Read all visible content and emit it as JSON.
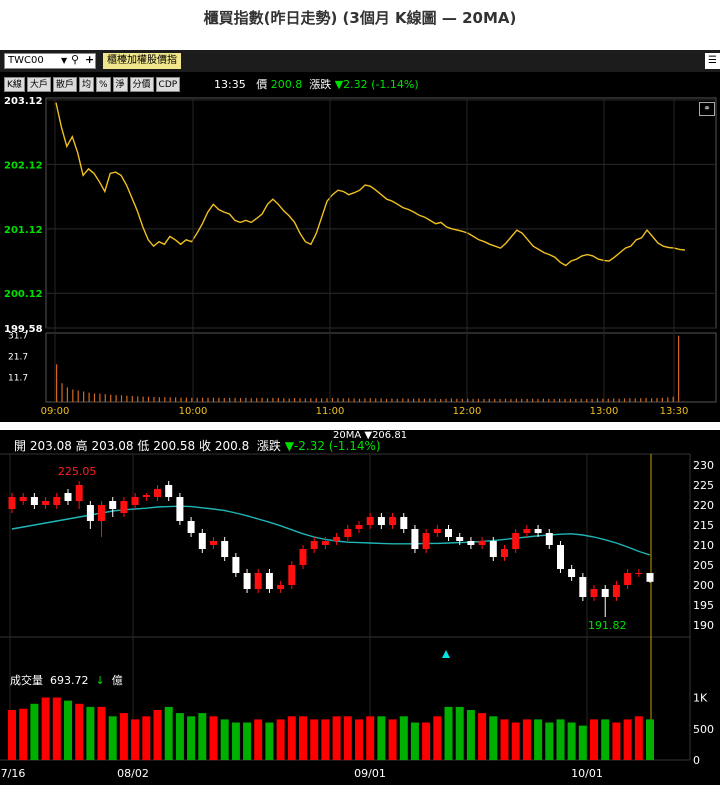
{
  "page_title": "櫃買指數(昨日走勢) (3個月 K線圖 — 20MA)",
  "toolbar": {
    "symbol": "TWC00",
    "index_name": "櫃檯加權股價指",
    "buttons": [
      "K線",
      "大戶",
      "散戶",
      "均",
      "%",
      "淨",
      "分價",
      "CDP"
    ],
    "time": "13:35",
    "price_label": "價",
    "price": "200.8",
    "change_label": "漲跌",
    "change": "▼2.32 (-1.14%)"
  },
  "colors": {
    "up": "#ff1010",
    "down": "#ffffff",
    "volume_up": "#ff0000",
    "volume_down": "#00b000",
    "ma": "#1fb5b5",
    "intraday": "#f0c020",
    "intraday_volume": "#d2691e"
  },
  "chart_data": [
    {
      "type": "line",
      "title": "",
      "x_ticks": [
        "09:00",
        "10:00",
        "11:00",
        "12:00",
        "13:00",
        "13:30"
      ],
      "y_ticks": [
        "203.12",
        "202.12",
        "201.12",
        "200.12",
        "199.58"
      ],
      "ylim": [
        199.58,
        203.12
      ],
      "series": [
        {
          "values": [
            203.08,
            202.7,
            202.4,
            202.55,
            202.3,
            201.95,
            202.05,
            201.98,
            201.85,
            201.7,
            201.98,
            202.0,
            201.95,
            201.8,
            201.6,
            201.4,
            201.15,
            200.95,
            200.85,
            200.92,
            200.88,
            201.0,
            200.95,
            200.88,
            200.95,
            200.92,
            201.05,
            201.2,
            201.38,
            201.5,
            201.42,
            201.38,
            201.35,
            201.25,
            201.22,
            201.25,
            201.22,
            201.28,
            201.35,
            201.5,
            201.58,
            201.5,
            201.4,
            201.32,
            201.22,
            201.05,
            200.92,
            200.88,
            201.05,
            201.3,
            201.55,
            201.65,
            201.72,
            201.7,
            201.65,
            201.68,
            201.72,
            201.8,
            201.78,
            201.72,
            201.65,
            201.58,
            201.55,
            201.5,
            201.45,
            201.42,
            201.38,
            201.33,
            201.3,
            201.25,
            201.2,
            201.22,
            201.15,
            201.12,
            201.1,
            201.08,
            201.05,
            201.0,
            200.95,
            200.92,
            200.88,
            200.85,
            200.82,
            200.9,
            201.0,
            201.1,
            201.05,
            200.95,
            200.85,
            200.8,
            200.75,
            200.72,
            200.68,
            200.6,
            200.55,
            200.62,
            200.65,
            200.7,
            200.72,
            200.7,
            200.65,
            200.63,
            200.62,
            200.68,
            200.75,
            200.82,
            200.85,
            200.95,
            200.98,
            201.1,
            201.0,
            200.9,
            200.85,
            200.83,
            200.82,
            200.8,
            200.79
          ]
        }
      ]
    },
    {
      "type": "bar",
      "title": "",
      "y_ticks": [
        "31.7",
        "21.7",
        "11.7"
      ],
      "ylim": [
        0,
        33
      ],
      "series": [
        {
          "values": [
            18,
            9,
            7,
            6,
            5.5,
            5,
            4.5,
            4,
            4,
            3.8,
            3.5,
            3.3,
            3.2,
            3,
            2.8,
            2.7,
            2.6,
            2.5,
            2.4,
            2.3,
            2.3,
            2.2,
            2.2,
            2.1,
            2.1,
            2,
            2,
            2,
            2,
            2.1,
            2,
            1.9,
            2,
            2,
            1.9,
            2,
            1.8,
            1.9,
            2,
            1.8,
            2,
            1.9,
            1.8,
            1.7,
            1.9,
            1.8,
            1.7,
            1.8,
            1.8,
            1.7,
            1.8,
            1.9,
            1.8,
            1.7,
            1.8,
            1.7,
            1.6,
            1.7,
            1.8,
            1.7,
            1.7,
            1.6,
            1.7,
            1.6,
            1.7,
            1.6,
            1.6,
            1.7,
            1.6,
            1.7,
            1.6,
            1.5,
            1.6,
            1.7,
            1.6,
            1.5,
            1.6,
            1.5,
            1.6,
            1.5,
            1.6,
            1.5,
            1.5,
            1.6,
            1.5,
            1.6,
            1.5,
            1.5,
            1.6,
            1.5,
            1.6,
            1.5,
            1.5,
            1.6,
            1.5,
            1.6,
            1.5,
            1.6,
            1.5,
            1.5,
            1.7,
            1.6,
            1.6,
            1.7,
            1.6,
            1.7,
            1.8,
            1.7,
            1.8,
            1.9,
            1.8,
            1.9,
            2,
            2.2,
            2.5,
            31.7
          ]
        }
      ]
    },
    {
      "type": "candlestick",
      "title": "",
      "info": {
        "open_label": "開",
        "open": "203.08",
        "high_label": "高",
        "high": "203.08",
        "low_label": "低",
        "low": "200.58",
        "close_label": "收",
        "close": "200.8",
        "change_label": "漲跌",
        "change": "▼-2.32 (-1.14%)"
      },
      "ma_label": "20MA ▼206.81",
      "annotations": {
        "high": "225.05",
        "low": "191.82"
      },
      "x_ticks": [
        "7/16",
        "08/02",
        "09/01",
        "10/01"
      ],
      "y_ticks": [
        "230",
        "225",
        "220",
        "215",
        "210",
        "205",
        "200",
        "195",
        "190"
      ],
      "ylim": [
        187,
        232
      ],
      "candles": [
        [
          219,
          222,
          223,
          218
        ],
        [
          221,
          222,
          223,
          220
        ],
        [
          222,
          220,
          223,
          219
        ],
        [
          220,
          221,
          222,
          219
        ],
        [
          220,
          222,
          223,
          219
        ],
        [
          223,
          221,
          224,
          220
        ],
        [
          221,
          225,
          226,
          219
        ],
        [
          220,
          216,
          221,
          214
        ],
        [
          216,
          220,
          221,
          212
        ],
        [
          221,
          219,
          222,
          217
        ],
        [
          218,
          221,
          222,
          217
        ],
        [
          220,
          222,
          223,
          219
        ],
        [
          222,
          222.5,
          223,
          221
        ],
        [
          222,
          224,
          225,
          221
        ],
        [
          225,
          222,
          226,
          221
        ],
        [
          222,
          216,
          223,
          215
        ],
        [
          216,
          213,
          217,
          212
        ],
        [
          213,
          209,
          214,
          208
        ],
        [
          210,
          211,
          212,
          209
        ],
        [
          211,
          207,
          212,
          206
        ],
        [
          207,
          203,
          208,
          202
        ],
        [
          203,
          199,
          204,
          198
        ],
        [
          199,
          203,
          204,
          198
        ],
        [
          203,
          199,
          204,
          198
        ],
        [
          199,
          200,
          201,
          198
        ],
        [
          200,
          205,
          206,
          199
        ],
        [
          205,
          209,
          210,
          204
        ],
        [
          209,
          211,
          212,
          208
        ],
        [
          210,
          211,
          212,
          209
        ],
        [
          211,
          212,
          213,
          210
        ],
        [
          212,
          214,
          215,
          211
        ],
        [
          214,
          215,
          216,
          213
        ],
        [
          215,
          217,
          218,
          214
        ],
        [
          217,
          215,
          218,
          214
        ],
        [
          215,
          217,
          218,
          214
        ],
        [
          217,
          214,
          218,
          213
        ],
        [
          214,
          209,
          215,
          208
        ],
        [
          209,
          213,
          214,
          208
        ],
        [
          213,
          214,
          215,
          212
        ],
        [
          214,
          212,
          215,
          211
        ],
        [
          212,
          211,
          213,
          210
        ],
        [
          211,
          210,
          212,
          209
        ],
        [
          210,
          211,
          212,
          209
        ],
        [
          211,
          207,
          212,
          206
        ],
        [
          207,
          209,
          210,
          206
        ],
        [
          209,
          213,
          214,
          208
        ],
        [
          213,
          214,
          215,
          212
        ],
        [
          214,
          213,
          215,
          212
        ],
        [
          213,
          210,
          214,
          209
        ],
        [
          210,
          204,
          211,
          203
        ],
        [
          204,
          202,
          205,
          201
        ],
        [
          202,
          197,
          203,
          196
        ],
        [
          197,
          199,
          200,
          196
        ],
        [
          199,
          197,
          200,
          192
        ],
        [
          197,
          200,
          201,
          196
        ],
        [
          200,
          203,
          204,
          199
        ],
        [
          203,
          203,
          204,
          202
        ],
        [
          203,
          200.8,
          203,
          200.58
        ]
      ],
      "ma20": [
        214,
        214.5,
        215,
        215.5,
        216,
        216.5,
        217,
        217.5,
        218,
        218.5,
        218.8,
        219,
        219.2,
        219.5,
        219.6,
        219.7,
        219.6,
        219.3,
        219,
        218.6,
        218,
        217.3,
        216.5,
        215.7,
        214.8,
        213.8,
        212.8,
        212,
        211.4,
        211,
        210.7,
        210.6,
        210.5,
        210.4,
        210.3,
        210.3,
        210.3,
        210.4,
        210.4,
        210.5,
        210.6,
        210.7,
        210.9,
        211.1,
        211.4,
        211.7,
        212,
        212.3,
        212.5,
        212.7,
        212.8,
        212.5,
        212,
        211.3,
        210.5,
        209.5,
        208.4,
        207.5
      ],
      "volume_ylim": [
        0,
        1200
      ],
      "volume_y_ticks": [
        "1K",
        "500",
        "0"
      ],
      "volume": [
        800,
        820,
        900,
        1000,
        1000,
        950,
        900,
        850,
        850,
        700,
        750,
        650,
        700,
        800,
        850,
        750,
        700,
        750,
        700,
        650,
        600,
        600,
        650,
        600,
        650,
        700,
        700,
        650,
        650,
        700,
        700,
        650,
        700,
        700,
        650,
        700,
        600,
        600,
        700,
        850,
        850,
        800,
        750,
        700,
        650,
        600,
        650,
        650,
        600,
        650,
        600,
        550,
        650,
        650,
        600,
        650,
        700,
        650
      ],
      "volume_info": {
        "label": "成交量",
        "value": "693.72",
        "arrow": "↓",
        "unit": "億"
      }
    }
  ]
}
